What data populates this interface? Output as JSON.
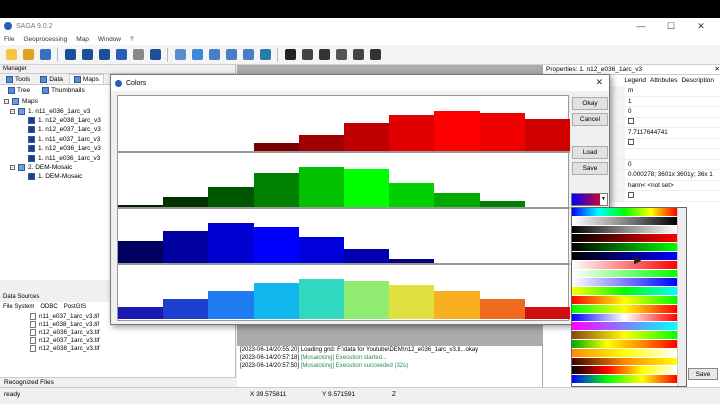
{
  "window": {
    "title": "SAGA 9.0.2",
    "min": "—",
    "max": "☐",
    "close": "✕"
  },
  "menu": [
    "File",
    "Geoprocessing",
    "Map",
    "Window",
    "?"
  ],
  "toolbar_icons": [
    "open-icon",
    "open-folder-icon",
    "save-icon",
    "table-icon",
    "grid-icon",
    "layers-icon",
    "info-icon",
    "settings-icon",
    "help-icon",
    "map-icon",
    "3d-icon",
    "histogram-icon",
    "scatter-icon",
    "layout-icon",
    "globe-icon",
    "pointer-icon",
    "zoom-icon",
    "pan-icon",
    "move-icon",
    "print-icon",
    "measure-icon"
  ],
  "manager": {
    "header": "Manager",
    "tabs": [
      "Tools",
      "Data",
      "Maps"
    ],
    "subtabs": [
      "Tree",
      "Thumbnails"
    ],
    "tree": [
      {
        "label": "Maps",
        "level": 0
      },
      {
        "label": "1. n11_e036_1arc_v3",
        "level": 1
      },
      {
        "label": "1. n12_e038_1arc_v3",
        "level": 2
      },
      {
        "label": "1. n12_e037_1arc_v3",
        "level": 2
      },
      {
        "label": "1. n11_e037_1arc_v3",
        "level": 2
      },
      {
        "label": "1. n12_e036_1arc_v3",
        "level": 2
      },
      {
        "label": "1. n11_e036_1arc_v3",
        "level": 2
      },
      {
        "label": "2. DEM-Mosaic",
        "level": 1
      },
      {
        "label": "1. DEM-Mosaic",
        "level": 2
      }
    ]
  },
  "datasources": {
    "header": "Data Sources",
    "tabs": [
      "File System",
      "ODBC",
      "PostGIS"
    ],
    "files": [
      "n11_e037_1arc_v3.tif",
      "n11_e038_1arc_v3.tif",
      "n12_e036_1arc_v3.tif",
      "n12_e037_1arc_v3.tif",
      "n12_e038_1arc_v3.tif"
    ],
    "recognized": "Recognized Files"
  },
  "messages": [
    {
      "ts": "[2023-06-14/20:55:20]",
      "text": " Loading grid: F:\\data for Youtube\\DEM\\n12_e036_1arc_v3.ti...okay",
      "green": ""
    },
    {
      "ts": "[2023-06-14/20:57:18]",
      "text": "",
      "green": " [Mosaicking] Execution started..."
    },
    {
      "ts": "[2023-06-14/20:57:50]",
      "text": "",
      "green": " [Mosaicking] Execution succeeded (32s)"
    }
  ],
  "properties": {
    "header": "Properties: 1. n12_e036_1arc_v3",
    "tabs": [
      "Legend",
      "Attributes",
      "Description"
    ],
    "rows": [
      "m",
      "1",
      "0",
      "",
      "7.7117644741",
      "",
      "",
      "0",
      "0.000278; 3601x 3601y; 36x 1",
      "hann< <not set>",
      ""
    ],
    "save": "Save"
  },
  "status": {
    "left": "ready",
    "x": "X 39.575811",
    "y": "Y 9.571591",
    "z": "Z"
  },
  "dialog": {
    "title": "Colors",
    "buttons": [
      "Okay",
      "Cancel",
      "Load",
      "Save"
    ]
  },
  "chart_data": {
    "type": "bar",
    "title": "",
    "series": [
      {
        "values": [
          0,
          0,
          0,
          0.2,
          0.4,
          0.7,
          0.9,
          1.0,
          0.95,
          0.8
        ],
        "color": "red"
      },
      {
        "values": [
          0.05,
          0.25,
          0.5,
          0.85,
          1.0,
          0.95,
          0.6,
          0.35,
          0.15,
          0
        ],
        "color": "green"
      },
      {
        "values": [
          0.55,
          0.8,
          1.0,
          0.9,
          0.65,
          0.35,
          0.1,
          0,
          0,
          0
        ],
        "color": "blue"
      },
      {
        "values": [
          0.3,
          0.5,
          0.7,
          0.9,
          1.0,
          0.95,
          0.85,
          0.7,
          0.5,
          0.3
        ],
        "color": "combined"
      }
    ]
  }
}
